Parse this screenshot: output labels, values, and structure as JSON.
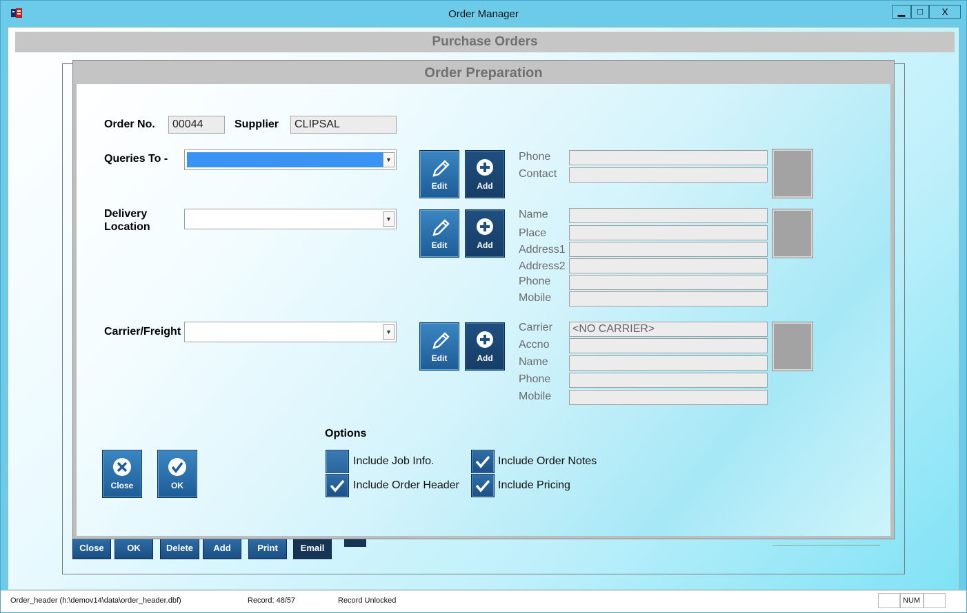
{
  "window": {
    "title": "Order Manager",
    "min_label": "▁",
    "max_label": "□",
    "close_label": "X"
  },
  "purchase_orders": {
    "header": "Purchase Orders",
    "buttons": [
      "Close",
      "OK",
      "Delete",
      "Add",
      "Print",
      "Email"
    ]
  },
  "dialog": {
    "title": "Order Preparation",
    "order_no_label": "Order No.",
    "order_no_value": "00044",
    "supplier_label": "Supplier",
    "supplier_value": "CLIPSAL",
    "queries": {
      "label": "Queries To -",
      "edit_label": "Edit",
      "add_label": "Add",
      "fields": [
        {
          "label": "Phone",
          "value": ""
        },
        {
          "label": "Contact",
          "value": ""
        }
      ]
    },
    "delivery": {
      "label_line1": "Delivery",
      "label_line2": "Location",
      "edit_label": "Edit",
      "add_label": "Add",
      "fields": [
        {
          "label": "Name",
          "value": ""
        },
        {
          "label": "Place",
          "value": ""
        },
        {
          "label": "Address1",
          "value": ""
        },
        {
          "label": "Address2",
          "value": ""
        },
        {
          "label": "Phone",
          "value": ""
        },
        {
          "label": "Mobile",
          "value": ""
        }
      ]
    },
    "carrier": {
      "label": "Carrier/Freight",
      "edit_label": "Edit",
      "add_label": "Add",
      "fields": [
        {
          "label": "Carrier",
          "value": "<NO CARRIER>"
        },
        {
          "label": "Accno",
          "value": ""
        },
        {
          "label": "Name",
          "value": ""
        },
        {
          "label": "Phone",
          "value": ""
        },
        {
          "label": "Mobile",
          "value": ""
        }
      ]
    },
    "options": {
      "heading": "Options",
      "items": [
        {
          "label": "Include Job Info.",
          "checked": false
        },
        {
          "label": "Include Order Notes",
          "checked": true
        },
        {
          "label": "Include Order Header",
          "checked": true
        },
        {
          "label": "Include Pricing",
          "checked": true
        }
      ]
    },
    "close_label": "Close",
    "ok_label": "OK"
  },
  "statusbar": {
    "file": "Order_header (h:\\demov14\\data\\order_header.dbf)",
    "record": "Record: 48/57",
    "lock": "Record Unlocked",
    "num": "NUM"
  },
  "colors": {
    "titlebar": "#6ccbe8",
    "button_blue": "#1e5c97",
    "selection": "#3b94f4"
  }
}
